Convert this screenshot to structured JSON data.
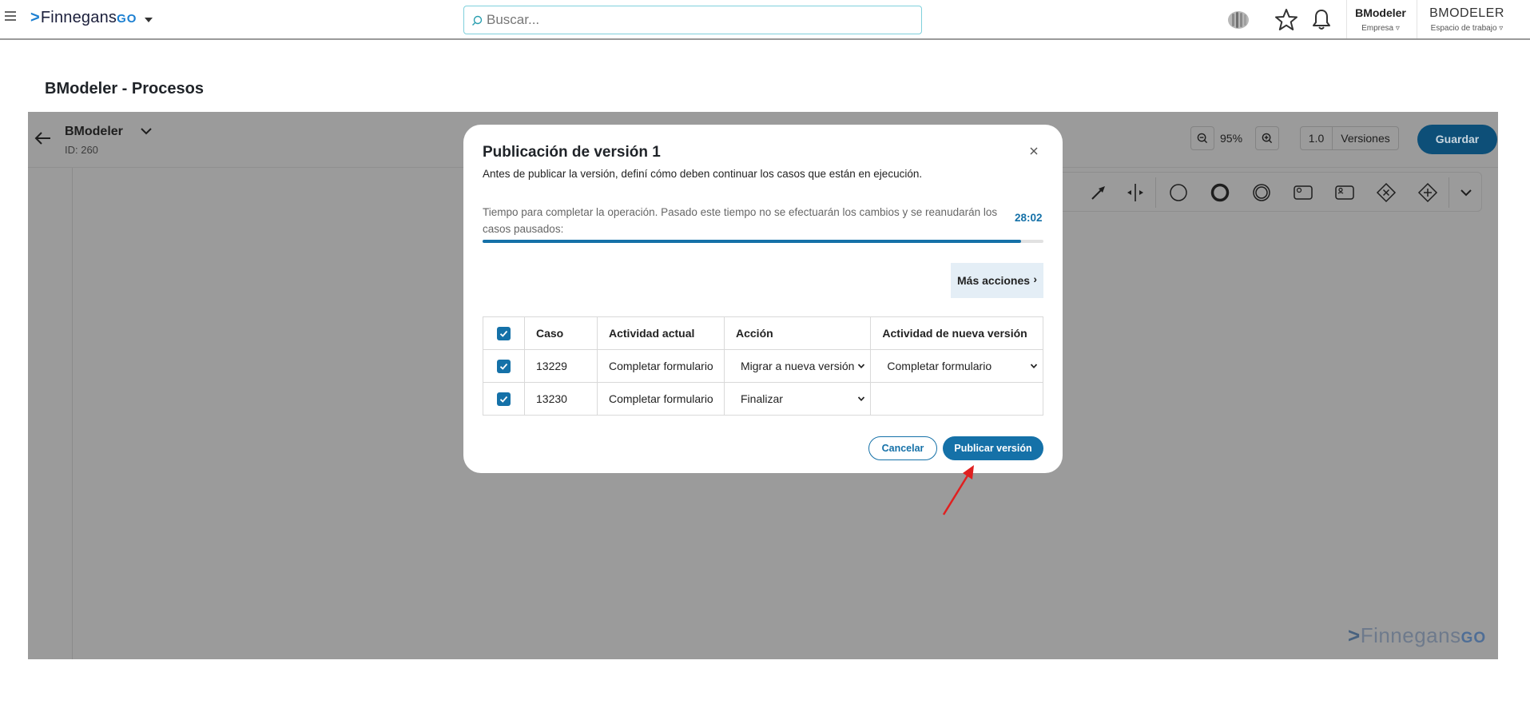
{
  "topbar": {
    "logo_main": "Finnegans",
    "logo_go": "GO",
    "search_placeholder": "Buscar...",
    "company_name": "BModeler",
    "company_label": "Empresa ▿",
    "workspace_name": "BMODELER",
    "workspace_label": "Espacio de trabajo ▿"
  },
  "page": {
    "title": "BModeler - Procesos"
  },
  "editor": {
    "process_name": "BModeler",
    "process_id": "ID: 260",
    "zoom": "95%",
    "version_number": "1.0",
    "versions_label": "Versiones",
    "save_label": "Guardar",
    "watermark_main": "Finnegans",
    "watermark_go": "GO"
  },
  "modal": {
    "title": "Publicación de versión 1",
    "subtitle": "Antes de publicar la versión, definí cómo deben continuar los casos que están en ejecución.",
    "timer_text": "Tiempo para completar la operación. Pasado este tiempo no se efectuarán los cambios y se reanudarán los casos pausados:",
    "timer_value": "28:02",
    "progress_fraction": 0.96,
    "more_actions_label": "Más acciones",
    "more_actions_arrow": "›",
    "table": {
      "headers": [
        "Caso",
        "Actividad actual",
        "Acción",
        "Actividad de nueva versión"
      ],
      "rows": [
        {
          "case": "13229",
          "current": "Completar formulario",
          "action": "Migrar a nueva versión",
          "new_activity": "Completar formulario"
        },
        {
          "case": "13230",
          "current": "Completar formulario",
          "action": "Finalizar",
          "new_activity": ""
        }
      ]
    },
    "cancel_label": "Cancelar",
    "publish_label": "Publicar versión"
  },
  "colors": {
    "primary": "#1571a8",
    "overlay": "#9b9b9b",
    "pointer": "#e02020"
  },
  "icons": [
    "hamburger-icon",
    "search-icon",
    "brain-icon",
    "star-icon",
    "bell-icon",
    "back-arrow-icon",
    "chevron-down-icon",
    "zoom-out-icon",
    "zoom-in-icon",
    "close-icon",
    "check-icon",
    "red-arrow-pointer"
  ]
}
